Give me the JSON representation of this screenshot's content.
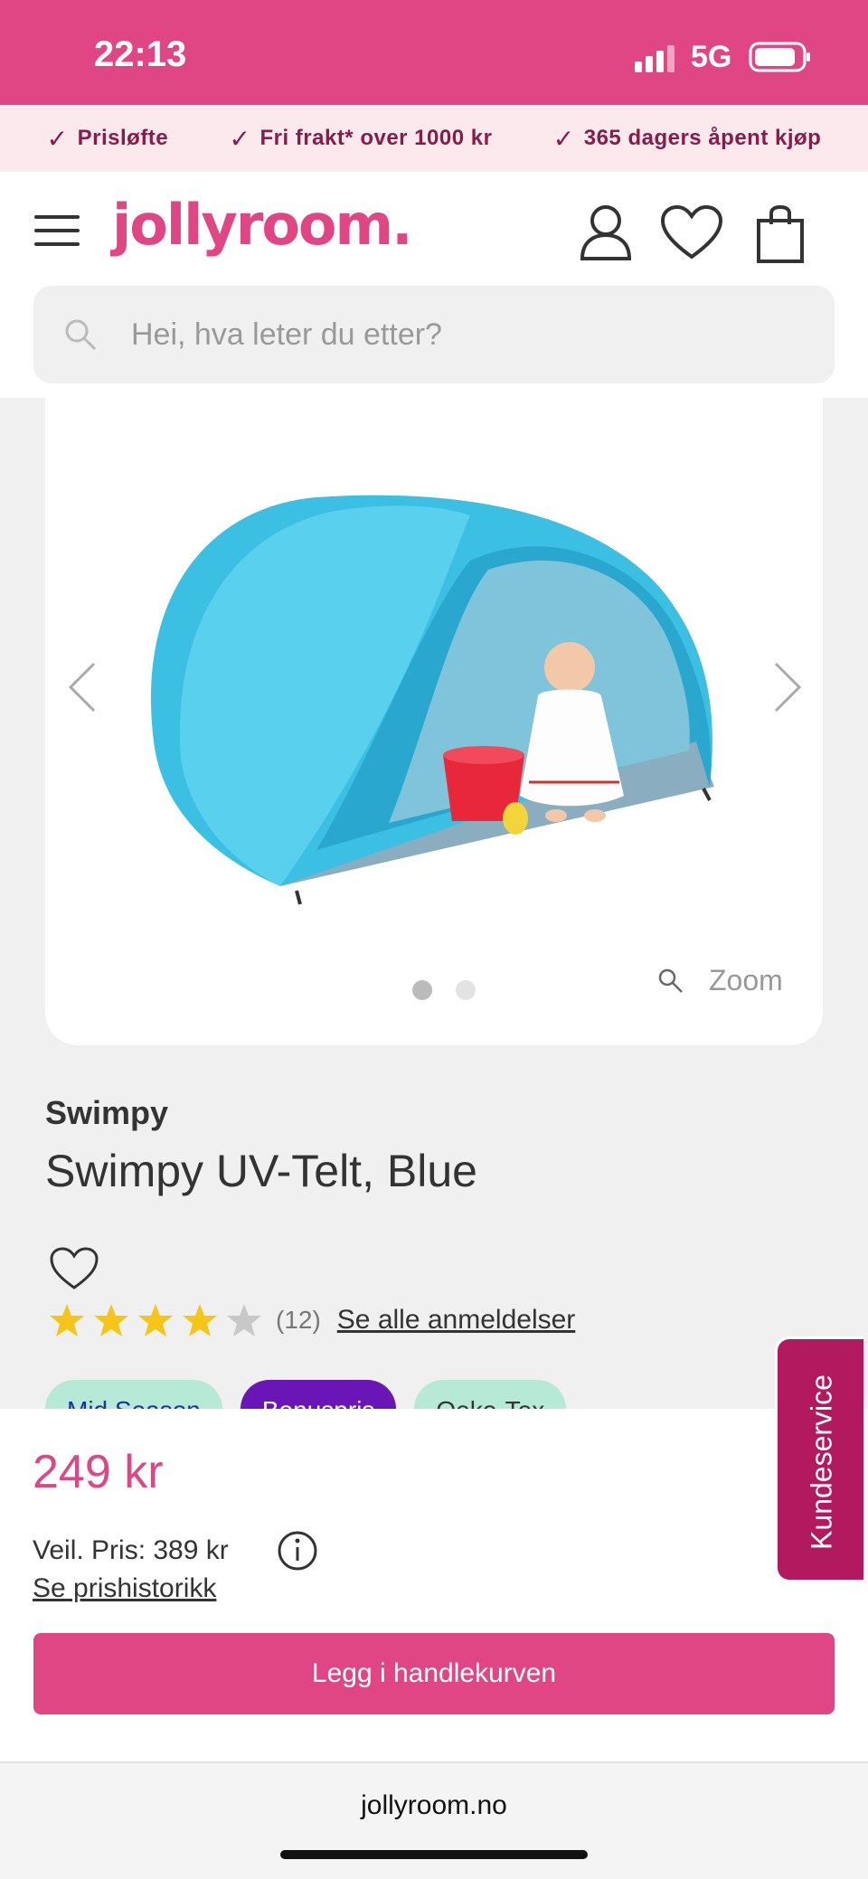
{
  "status_bar": {
    "time": "22:13",
    "network": "5G"
  },
  "usp_bar": {
    "items": [
      "Prisløfte",
      "Fri frakt* over 1000 kr",
      "365 dagers åpent kjøp"
    ]
  },
  "header": {
    "logo": "jollyroom."
  },
  "search": {
    "placeholder": "Hei, hva leter du etter?"
  },
  "gallery": {
    "zoom_label": "Zoom",
    "image_count": 2,
    "active_image": 1
  },
  "product": {
    "brand": "Swimpy",
    "title": "Swimpy UV-Telt, Blue",
    "rating": {
      "value": 4,
      "max": 5,
      "count": "(12)",
      "reviews_link": "Se alle anmeldelser"
    },
    "tags": [
      "Mid Season",
      "Bonuspris",
      "Oeko-Tex"
    ]
  },
  "pricing": {
    "price": "249 kr",
    "recommended": "Veil. Pris: 389 kr",
    "history_link": "Se prishistorikk",
    "cta": "Legg i handlekurven"
  },
  "side_tab": {
    "label": "Kundeservice"
  },
  "browser": {
    "url": "jollyroom.no"
  },
  "colors": {
    "brand_pink": "#e04684",
    "brand_dark": "#b3195e",
    "usp_bg": "#fbe9ee"
  }
}
